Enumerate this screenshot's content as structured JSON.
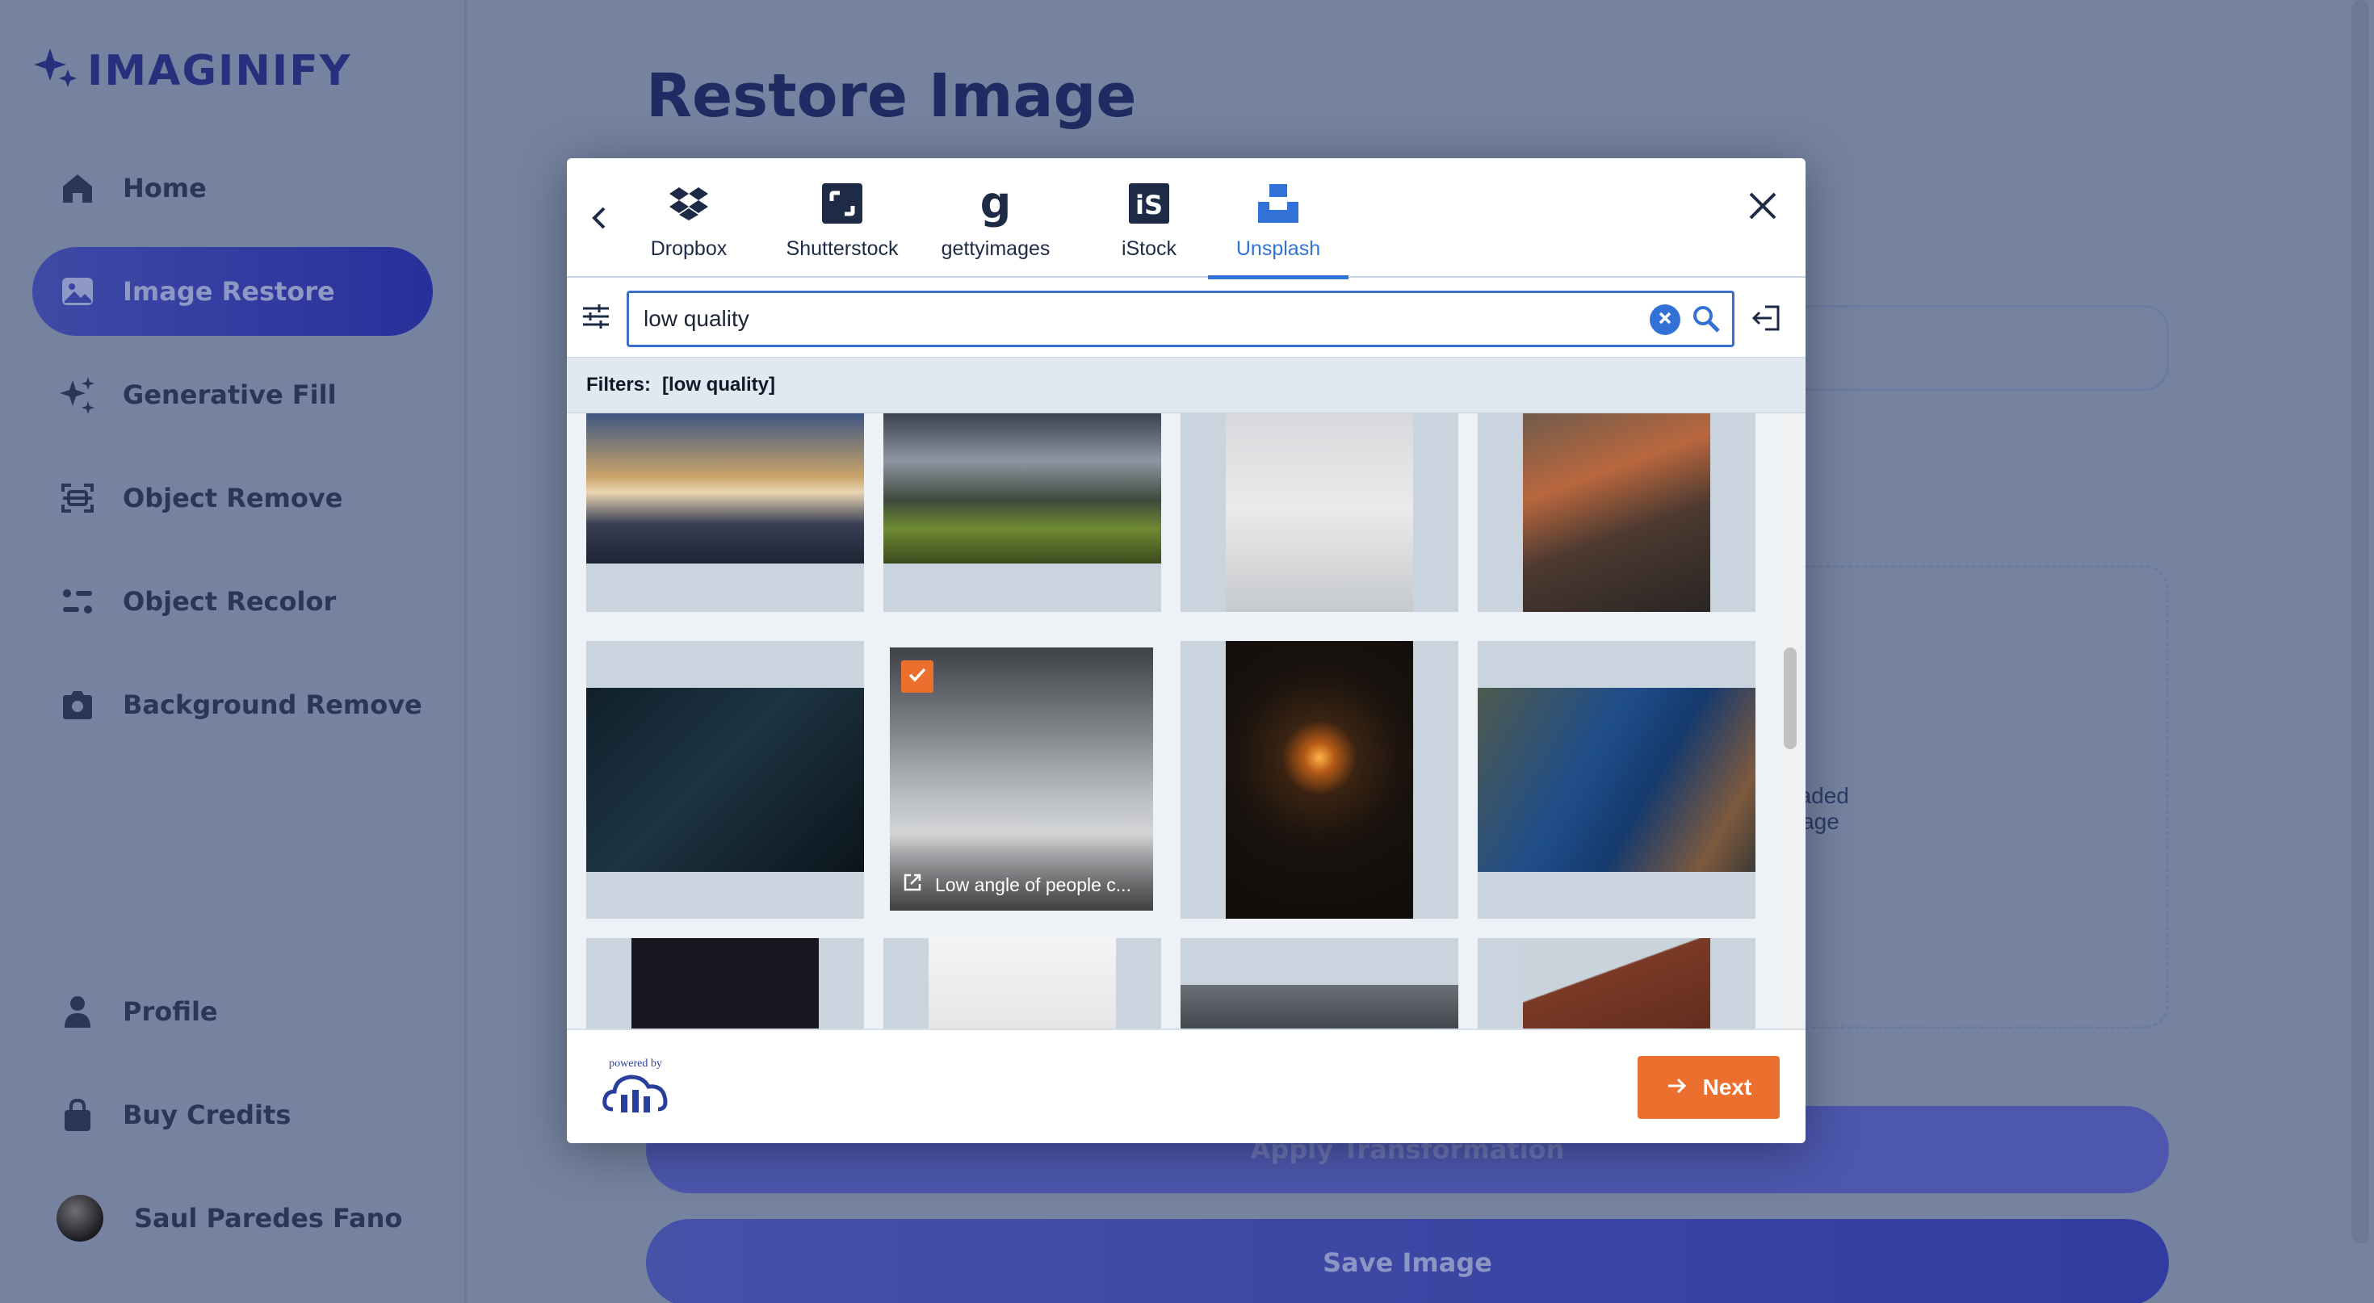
{
  "app": {
    "name": "IMAGINIFY"
  },
  "sidebar": {
    "items": [
      {
        "label": "Home",
        "icon": "home-icon",
        "active": false
      },
      {
        "label": "Image Restore",
        "icon": "image-icon",
        "active": true
      },
      {
        "label": "Generative Fill",
        "icon": "stars-icon",
        "active": false
      },
      {
        "label": "Object Remove",
        "icon": "scan-icon",
        "active": false
      },
      {
        "label": "Object Recolor",
        "icon": "filter-icon",
        "active": false
      },
      {
        "label": "Background Remove",
        "icon": "camera-icon",
        "active": false
      }
    ],
    "bottom": [
      {
        "label": "Profile",
        "icon": "profile-icon"
      },
      {
        "label": "Buy Credits",
        "icon": "bag-icon"
      }
    ],
    "user": {
      "name": "Saul Paredes Fano"
    }
  },
  "main": {
    "title": "Restore Image",
    "uploaded_label": "Uploaded Image",
    "apply_label": "Apply Transformation",
    "save_label": "Save Image"
  },
  "modal": {
    "sources": [
      {
        "label": "Dropbox",
        "icon": "dropbox-icon",
        "active": false
      },
      {
        "label": "Shutterstock",
        "icon": "shutterstock-icon",
        "active": false
      },
      {
        "label": "gettyimages",
        "icon": "gettyimages-icon",
        "active": false
      },
      {
        "label": "iStock",
        "icon": "istock-icon",
        "active": false
      },
      {
        "label": "Unsplash",
        "icon": "unsplash-icon",
        "active": true
      }
    ],
    "search": {
      "value": "low quality"
    },
    "filters_label": "Filters:",
    "filters_value": "[low quality]",
    "selected_caption": "Low angle of people c...",
    "powered_by": "powered by",
    "next_label": "Next"
  },
  "colors": {
    "accent": "#3271d6",
    "action": "#ec6f2e",
    "brand": "#27307d",
    "overlay": "#7583a0"
  }
}
